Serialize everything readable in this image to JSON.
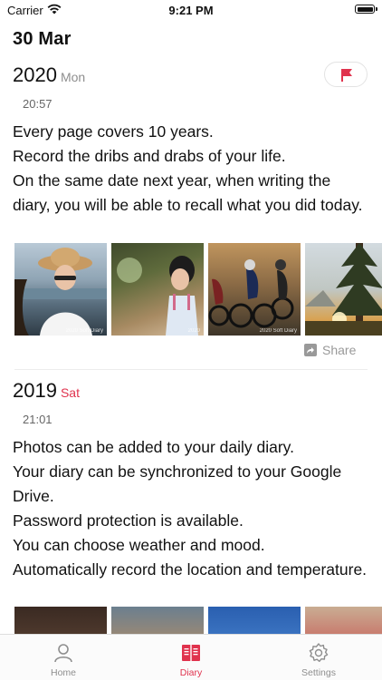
{
  "status_bar": {
    "carrier": "Carrier",
    "time": "9:21 PM"
  },
  "header": {
    "date": "30 Mar"
  },
  "entries": [
    {
      "year": "2020",
      "weekday": "Mon",
      "weekday_color": "#8e8e8e",
      "time": "20:57",
      "text": "Every page covers 10 years.\nRecord the dribs and drabs of your life.\nOn the same date next year, when writing the diary, you will be able to recall what you did today.",
      "photos": [
        {
          "icon": "photo-girl-straw-hat",
          "watermark": "2020 Soft Diary"
        },
        {
          "icon": "photo-child-outdoors",
          "watermark": "2020"
        },
        {
          "icon": "photo-cyclists",
          "watermark": "2020 Soft Diary"
        },
        {
          "icon": "photo-forest-sunset",
          "watermark": ""
        }
      ],
      "share_label": "Share"
    },
    {
      "year": "2019",
      "weekday": "Sat",
      "weekday_color": "#e0334e",
      "time": "21:01",
      "text": "Photos can be added to your daily diary.\nYour diary can be synchronized to your Google Drive.\nPassword protection is available.\nYou can choose weather and mood.\nAutomatically record the location and temperature."
    }
  ],
  "tabs": [
    {
      "label": "Home",
      "icon": "person-icon"
    },
    {
      "label": "Diary",
      "icon": "book-icon",
      "active": true
    },
    {
      "label": "Settings",
      "icon": "gear-icon"
    }
  ],
  "colors": {
    "accent": "#e0334e",
    "flag": "#e0334e"
  }
}
